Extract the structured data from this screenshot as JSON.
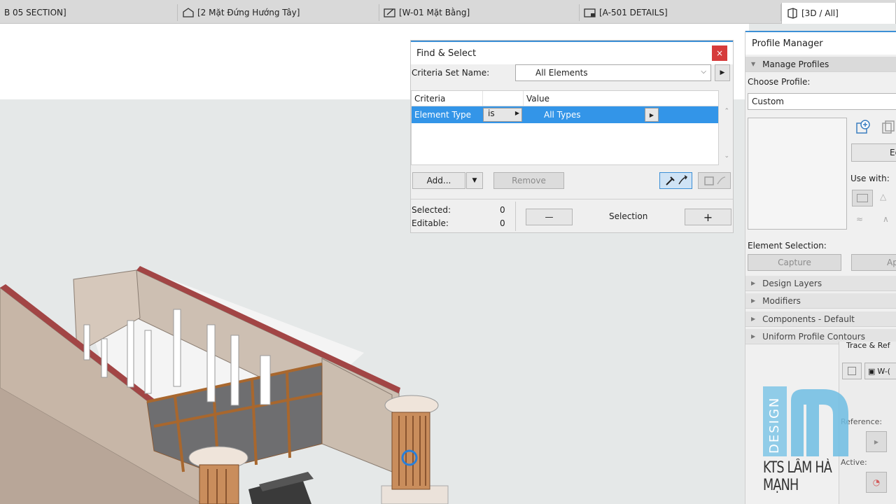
{
  "tabs": [
    {
      "label": "B 05 SECTION]",
      "icon": "section-icon"
    },
    {
      "label": "[2 Mặt Đứng Hướng Tây]",
      "icon": "elevation-house-icon"
    },
    {
      "label": "[W-01 Mặt Bằng]",
      "icon": "floor-plan-icon"
    },
    {
      "label": "[A-501 DETAILS]",
      "icon": "details-icon"
    },
    {
      "label": "[3D / All]",
      "icon": "3d-cube-icon",
      "active": true
    }
  ],
  "find_select": {
    "title": "Find & Select",
    "close_label": "×",
    "criteria_set_label": "Criteria Set Name:",
    "criteria_set_value": "All Elements",
    "headers": {
      "criteria": "Criteria",
      "value": "Value"
    },
    "row": {
      "criteria": "Element Type",
      "operator": "is",
      "value": "All Types"
    },
    "add_label": "Add...",
    "remove_label": "Remove",
    "selected_label": "Selected:",
    "selected_value": "0",
    "editable_label": "Editable:",
    "editable_value": "0",
    "minus_label": "—",
    "selection_label": "Selection",
    "plus_label": "+"
  },
  "profile_manager": {
    "title": "Profile Manager",
    "manage_profiles": "Manage Profiles",
    "choose_profile_label": "Choose Profile:",
    "choose_profile_value": "Custom",
    "edit_label": "Ed",
    "use_with_label": "Use with:",
    "element_selection_label": "Element Selection:",
    "capture_label": "Capture",
    "apply_label": "Ap",
    "sections": [
      "Design Layers",
      "Modifiers",
      "Components - Default",
      "Uniform Profile Contours"
    ],
    "trace_label": "Trace & Ref",
    "trace_item": "W-(",
    "reference_label": "Reference:",
    "active_label": "Active:"
  },
  "watermark": {
    "brand": "DESIGN",
    "letter": "m",
    "name": "KTS LÂM HÀ MẠNH"
  },
  "colors": {
    "accent": "#3395e8",
    "close": "#d63b3b",
    "wall_top": "#a24545",
    "column": "#c98d5c",
    "watermark_blue": "#7fc6e6"
  }
}
